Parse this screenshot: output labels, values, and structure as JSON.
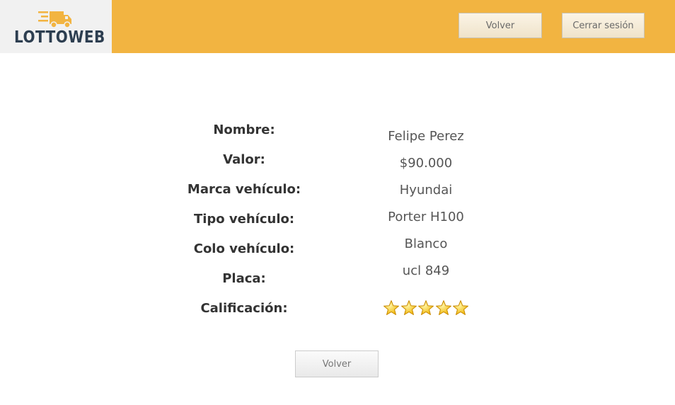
{
  "header": {
    "logo_text": "LOTTOWEB",
    "back_label": "Volver",
    "logout_label": "Cerrar sesión",
    "bg_color": "#f2b441"
  },
  "details": {
    "rows": [
      {
        "label": "Nombre:",
        "value": "Felipe Perez"
      },
      {
        "label": "Valor:",
        "value": "$90.000"
      },
      {
        "label": "Marca vehículo:",
        "value": "Hyundai"
      },
      {
        "label": "Tipo vehículo:",
        "value": "Porter H100"
      },
      {
        "label": "Colo vehículo:",
        "value": "Blanco"
      },
      {
        "label": "Placa:",
        "value": "ucl 849"
      }
    ],
    "rating_label": "Calificación:",
    "rating_stars": 5,
    "rating_max": 5,
    "star_icon": "star-icon"
  },
  "footer": {
    "back_label": "Volver"
  }
}
